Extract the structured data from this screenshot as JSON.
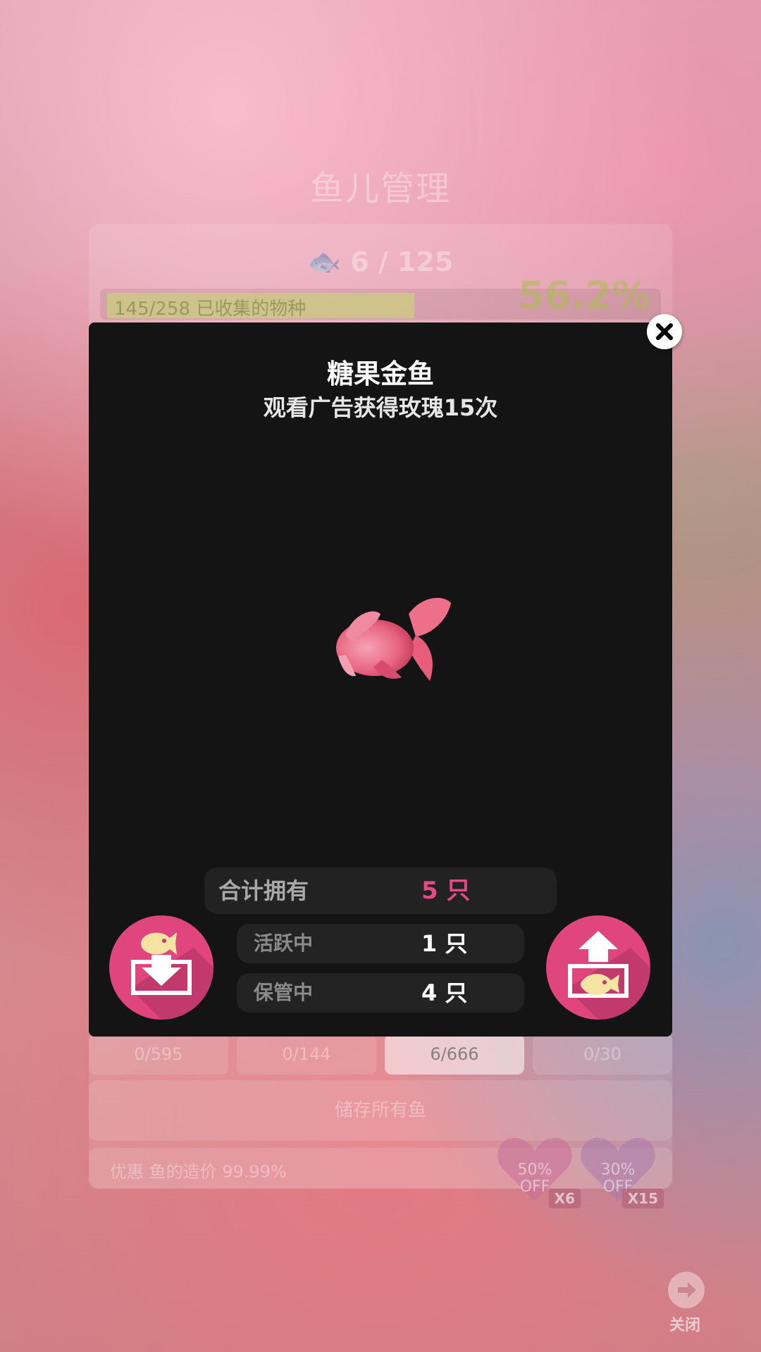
{
  "background": {
    "title": "鱼儿管理",
    "fish_count": "6 / 125",
    "collection_progress": {
      "text": "145/258 已收集的物种",
      "fraction": 0.562
    },
    "collection_percent": "56.2%",
    "tabs": [
      "0/595",
      "0/144",
      "6/666",
      "0/30"
    ],
    "store_all_label": "储存所有鱼",
    "discount_text": "优惠 鱼的造价 99.99%",
    "offers": [
      {
        "text": "50%",
        "off": "OFF",
        "multiplier": "X6"
      },
      {
        "text": "30%",
        "off": "OFF",
        "multiplier": "X15"
      }
    ],
    "close_label": "关闭"
  },
  "modal": {
    "fish_name": "糖果金鱼",
    "unlock_condition": "观看广告获得玫瑰15次",
    "total_label": "合计拥有",
    "total_value": "5 只",
    "active_label": "活跃中",
    "active_value": "1 只",
    "stored_label": "保管中",
    "stored_value": "4 只"
  },
  "icons": {
    "close": "close-icon",
    "store_fish": "fish-store-icon",
    "release_fish": "fish-release-icon",
    "arrow_right": "arrow-right-icon"
  },
  "colors": {
    "accent_pink": "#e0457e",
    "highlight_pink": "#e84886",
    "modal_bg": "#141414"
  }
}
